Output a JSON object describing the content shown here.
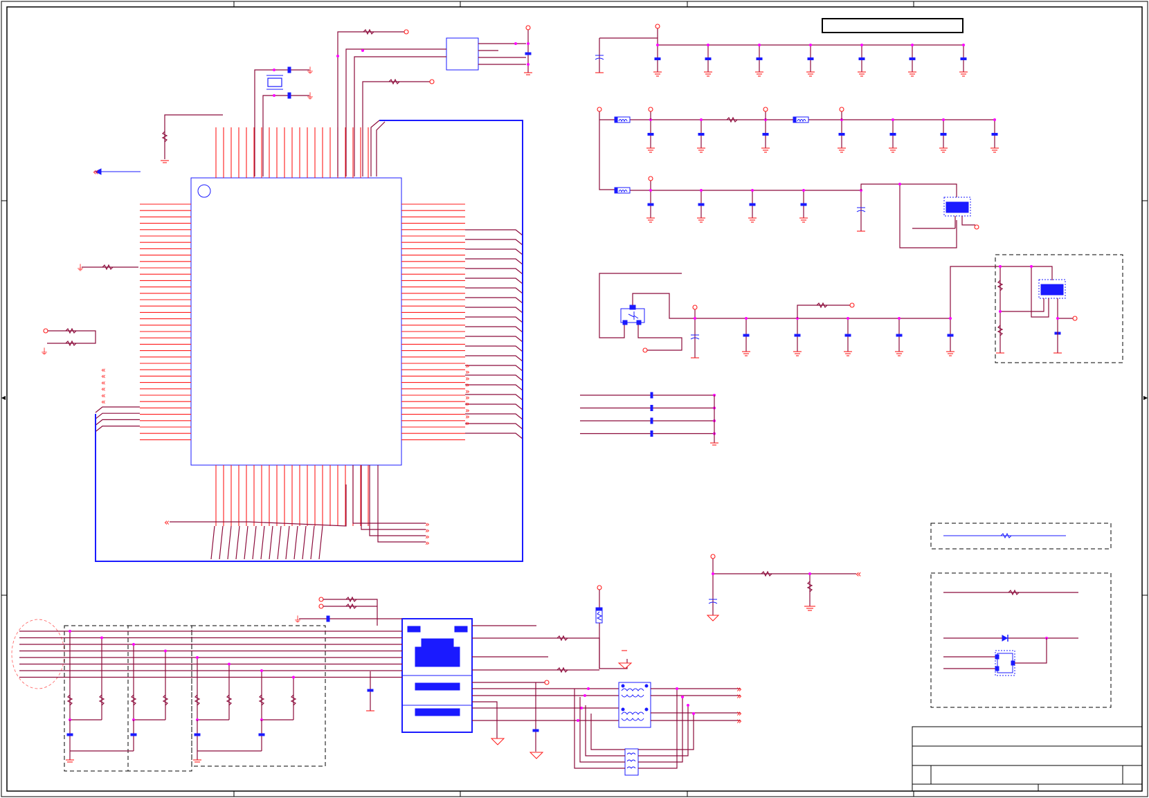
{
  "sheet": {
    "title_block_text": "",
    "label_box_text": ""
  },
  "colors": {
    "wire": "#8b0a3a",
    "pin": "#ff1a1a",
    "component": "#1a1aff",
    "junction": "#ff00ff",
    "border": "#000000"
  },
  "components": [
    "main-ic",
    "crystal",
    "voltage-regulator-1",
    "voltage-regulator-2",
    "transistor",
    "rj45-connector",
    "ethernet-transformer",
    "common-mode-choke",
    "esd-protection",
    "ferrite-bead",
    "diode",
    "fuse"
  ]
}
